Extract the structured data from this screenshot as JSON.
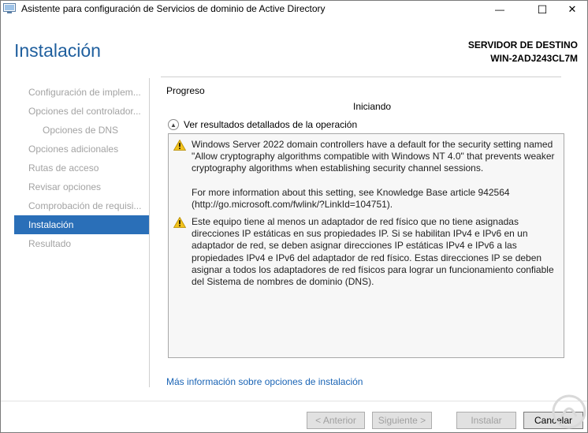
{
  "window": {
    "title": "Asistente para configuración de Servicios de dominio de Active Directory",
    "minimize_glyph": "—",
    "maximize_glyph": "☐",
    "close_glyph": "✕"
  },
  "header": {
    "page_title": "Instalación",
    "server_label": "SERVIDOR DE DESTINO",
    "server_name": "WIN-2ADJ243CL7M"
  },
  "nav": {
    "items": [
      {
        "label": "Configuración de implem...",
        "sub": false,
        "active": false
      },
      {
        "label": "Opciones del controlador...",
        "sub": false,
        "active": false
      },
      {
        "label": "Opciones de DNS",
        "sub": true,
        "active": false
      },
      {
        "label": "Opciones adicionales",
        "sub": false,
        "active": false
      },
      {
        "label": "Rutas de acceso",
        "sub": false,
        "active": false
      },
      {
        "label": "Revisar opciones",
        "sub": false,
        "active": false
      },
      {
        "label": "Comprobación de requisi...",
        "sub": false,
        "active": false
      },
      {
        "label": "Instalación",
        "sub": false,
        "active": true
      },
      {
        "label": "Resultado",
        "sub": false,
        "active": false
      }
    ]
  },
  "main": {
    "progress_label": "Progreso",
    "status": "Iniciando",
    "details_toggle": "Ver resultados detallados de la operación",
    "messages": [
      {
        "icon": "warning-icon",
        "paragraphs": [
          "Windows Server 2022 domain controllers have a default for the security setting named \"Allow cryptography algorithms compatible with Windows NT 4.0\" that prevents weaker cryptography algorithms when establishing security channel sessions.",
          "For more information about this setting, see Knowledge Base article 942564 (http://go.microsoft.com/fwlink/?LinkId=104751)."
        ]
      },
      {
        "icon": "warning-icon",
        "paragraphs": [
          "Este equipo tiene al menos un adaptador de red físico que no tiene asignadas direcciones IP estáticas en sus propiedades IP. Si se habilitan IPv4 e IPv6 en un adaptador de red, se deben asignar direcciones IP estáticas IPv4 e IPv6 a las propiedades IPv4 e IPv6 del adaptador de red físico. Estas direcciones IP se deben asignar a todos los adaptadores de red físicos para lograr un funcionamiento confiable del Sistema de nombres de dominio (DNS)."
        ]
      }
    ],
    "more_info_link": "Más información sobre opciones de instalación"
  },
  "footer": {
    "prev_label": "< Anterior",
    "next_label": "Siguiente >",
    "install_label": "Instalar",
    "cancel_label": "Cancelar"
  },
  "colors": {
    "accent": "#2a6fb8",
    "title_blue": "#1f5f9e",
    "link": "#1a64b5",
    "warning": "#f2c21b"
  }
}
